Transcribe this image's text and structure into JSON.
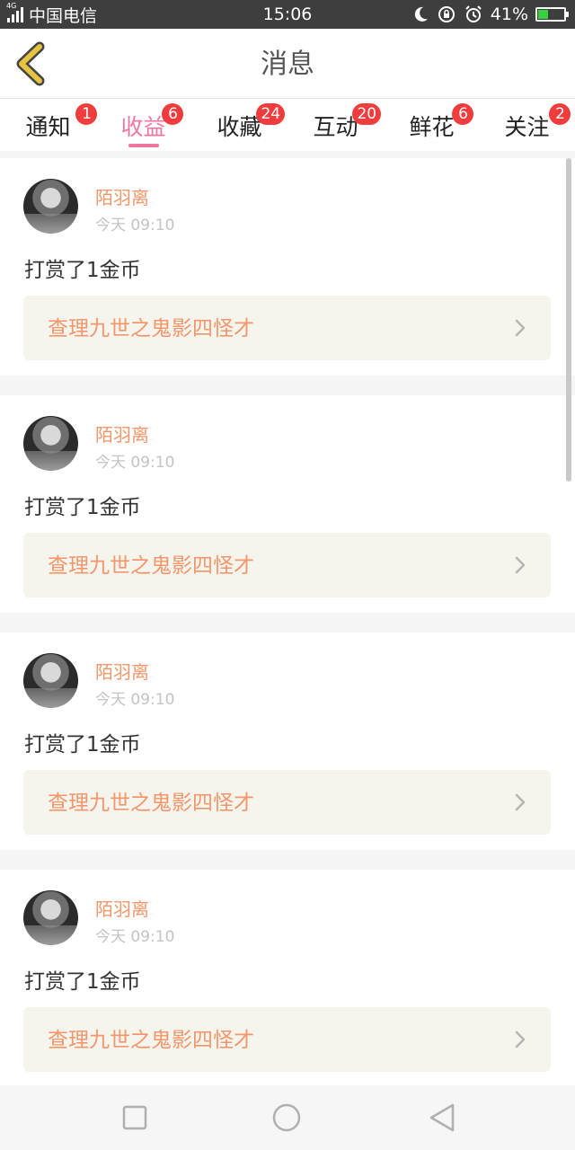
{
  "status_bar": {
    "network": "4G",
    "carrier": "中国电信",
    "time": "15:06",
    "battery": "41%",
    "battery_level": 0.41
  },
  "header": {
    "title": "消息",
    "back_icon": "chevron-left-icon"
  },
  "tabs": [
    {
      "label": "通知",
      "badge": "1",
      "active": false
    },
    {
      "label": "收益",
      "badge": "6",
      "active": true
    },
    {
      "label": "收藏",
      "badge": "24",
      "active": false
    },
    {
      "label": "互动",
      "badge": "20",
      "active": false
    },
    {
      "label": "鲜花",
      "badge": "6",
      "active": false
    },
    {
      "label": "关注",
      "badge": "2",
      "active": false
    }
  ],
  "messages": [
    {
      "user": "陌羽离",
      "time": "今天 09:10",
      "text": "打赏了1金币",
      "work": "查理九世之鬼影四怪才"
    },
    {
      "user": "陌羽离",
      "time": "今天 09:10",
      "text": "打赏了1金币",
      "work": "查理九世之鬼影四怪才"
    },
    {
      "user": "陌羽离",
      "time": "今天 09:10",
      "text": "打赏了1金币",
      "work": "查理九世之鬼影四怪才"
    },
    {
      "user": "陌羽离",
      "time": "今天 09:10",
      "text": "打赏了1金币",
      "work": "查理九世之鬼影四怪才"
    }
  ],
  "colors": {
    "accent": "#ee77a1",
    "username": "#f3966b",
    "badge": "#f03c3c",
    "back_icon": "#e6c43f"
  }
}
